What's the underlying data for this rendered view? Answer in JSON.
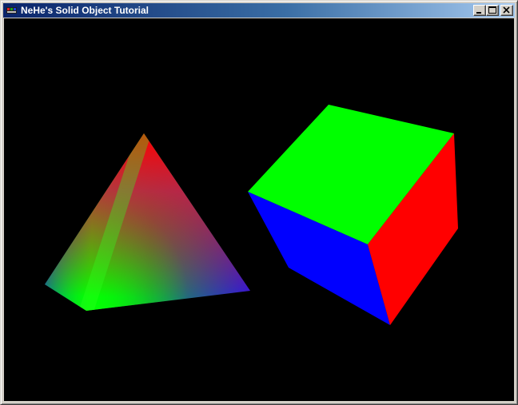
{
  "window": {
    "title": "NeHe's Solid Object Tutorial",
    "icon": "opengl-app-icon",
    "controls": [
      "minimize-icon",
      "maximize-icon",
      "close-icon"
    ]
  },
  "scene": {
    "background": "#000000",
    "objects": [
      {
        "name": "pyramid",
        "shading": "smooth",
        "vertex_colors": [
          "#ff0000",
          "#0000ff",
          "#00ff00",
          "#0000ff"
        ]
      },
      {
        "name": "cube",
        "face_colors": {
          "top": "#00ff00",
          "front": "#0000ff",
          "right": "#ff0000"
        }
      }
    ]
  }
}
